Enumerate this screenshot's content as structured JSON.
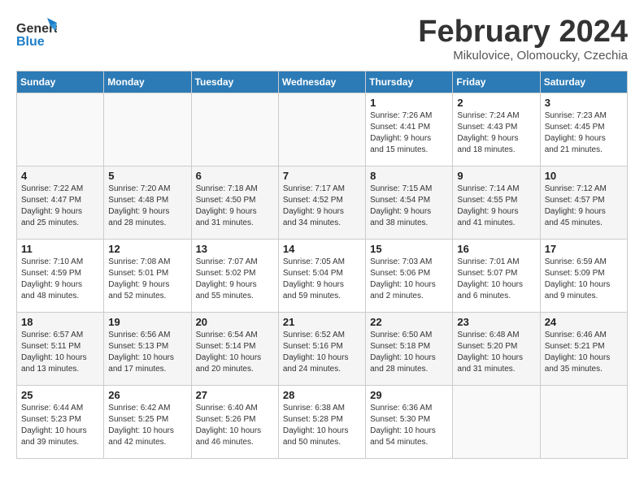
{
  "header": {
    "logo_general": "General",
    "logo_blue": "Blue",
    "month": "February 2024",
    "location": "Mikulovice, Olomoucky, Czechia"
  },
  "weekdays": [
    "Sunday",
    "Monday",
    "Tuesday",
    "Wednesday",
    "Thursday",
    "Friday",
    "Saturday"
  ],
  "weeks": [
    [
      {
        "day": "",
        "info": ""
      },
      {
        "day": "",
        "info": ""
      },
      {
        "day": "",
        "info": ""
      },
      {
        "day": "",
        "info": ""
      },
      {
        "day": "1",
        "info": "Sunrise: 7:26 AM\nSunset: 4:41 PM\nDaylight: 9 hours\nand 15 minutes."
      },
      {
        "day": "2",
        "info": "Sunrise: 7:24 AM\nSunset: 4:43 PM\nDaylight: 9 hours\nand 18 minutes."
      },
      {
        "day": "3",
        "info": "Sunrise: 7:23 AM\nSunset: 4:45 PM\nDaylight: 9 hours\nand 21 minutes."
      }
    ],
    [
      {
        "day": "4",
        "info": "Sunrise: 7:22 AM\nSunset: 4:47 PM\nDaylight: 9 hours\nand 25 minutes."
      },
      {
        "day": "5",
        "info": "Sunrise: 7:20 AM\nSunset: 4:48 PM\nDaylight: 9 hours\nand 28 minutes."
      },
      {
        "day": "6",
        "info": "Sunrise: 7:18 AM\nSunset: 4:50 PM\nDaylight: 9 hours\nand 31 minutes."
      },
      {
        "day": "7",
        "info": "Sunrise: 7:17 AM\nSunset: 4:52 PM\nDaylight: 9 hours\nand 34 minutes."
      },
      {
        "day": "8",
        "info": "Sunrise: 7:15 AM\nSunset: 4:54 PM\nDaylight: 9 hours\nand 38 minutes."
      },
      {
        "day": "9",
        "info": "Sunrise: 7:14 AM\nSunset: 4:55 PM\nDaylight: 9 hours\nand 41 minutes."
      },
      {
        "day": "10",
        "info": "Sunrise: 7:12 AM\nSunset: 4:57 PM\nDaylight: 9 hours\nand 45 minutes."
      }
    ],
    [
      {
        "day": "11",
        "info": "Sunrise: 7:10 AM\nSunset: 4:59 PM\nDaylight: 9 hours\nand 48 minutes."
      },
      {
        "day": "12",
        "info": "Sunrise: 7:08 AM\nSunset: 5:01 PM\nDaylight: 9 hours\nand 52 minutes."
      },
      {
        "day": "13",
        "info": "Sunrise: 7:07 AM\nSunset: 5:02 PM\nDaylight: 9 hours\nand 55 minutes."
      },
      {
        "day": "14",
        "info": "Sunrise: 7:05 AM\nSunset: 5:04 PM\nDaylight: 9 hours\nand 59 minutes."
      },
      {
        "day": "15",
        "info": "Sunrise: 7:03 AM\nSunset: 5:06 PM\nDaylight: 10 hours\nand 2 minutes."
      },
      {
        "day": "16",
        "info": "Sunrise: 7:01 AM\nSunset: 5:07 PM\nDaylight: 10 hours\nand 6 minutes."
      },
      {
        "day": "17",
        "info": "Sunrise: 6:59 AM\nSunset: 5:09 PM\nDaylight: 10 hours\nand 9 minutes."
      }
    ],
    [
      {
        "day": "18",
        "info": "Sunrise: 6:57 AM\nSunset: 5:11 PM\nDaylight: 10 hours\nand 13 minutes."
      },
      {
        "day": "19",
        "info": "Sunrise: 6:56 AM\nSunset: 5:13 PM\nDaylight: 10 hours\nand 17 minutes."
      },
      {
        "day": "20",
        "info": "Sunrise: 6:54 AM\nSunset: 5:14 PM\nDaylight: 10 hours\nand 20 minutes."
      },
      {
        "day": "21",
        "info": "Sunrise: 6:52 AM\nSunset: 5:16 PM\nDaylight: 10 hours\nand 24 minutes."
      },
      {
        "day": "22",
        "info": "Sunrise: 6:50 AM\nSunset: 5:18 PM\nDaylight: 10 hours\nand 28 minutes."
      },
      {
        "day": "23",
        "info": "Sunrise: 6:48 AM\nSunset: 5:20 PM\nDaylight: 10 hours\nand 31 minutes."
      },
      {
        "day": "24",
        "info": "Sunrise: 6:46 AM\nSunset: 5:21 PM\nDaylight: 10 hours\nand 35 minutes."
      }
    ],
    [
      {
        "day": "25",
        "info": "Sunrise: 6:44 AM\nSunset: 5:23 PM\nDaylight: 10 hours\nand 39 minutes."
      },
      {
        "day": "26",
        "info": "Sunrise: 6:42 AM\nSunset: 5:25 PM\nDaylight: 10 hours\nand 42 minutes."
      },
      {
        "day": "27",
        "info": "Sunrise: 6:40 AM\nSunset: 5:26 PM\nDaylight: 10 hours\nand 46 minutes."
      },
      {
        "day": "28",
        "info": "Sunrise: 6:38 AM\nSunset: 5:28 PM\nDaylight: 10 hours\nand 50 minutes."
      },
      {
        "day": "29",
        "info": "Sunrise: 6:36 AM\nSunset: 5:30 PM\nDaylight: 10 hours\nand 54 minutes."
      },
      {
        "day": "",
        "info": ""
      },
      {
        "day": "",
        "info": ""
      }
    ]
  ]
}
